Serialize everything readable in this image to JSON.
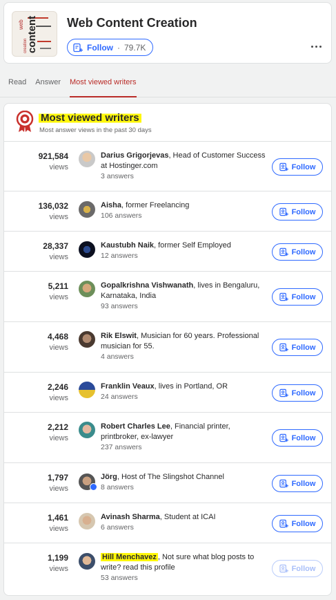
{
  "topic": {
    "title": "Web Content Creation",
    "image_words": [
      "web",
      "content",
      "creation"
    ],
    "follow_label": "Follow",
    "follower_count": "79.7K"
  },
  "tabs": [
    {
      "label": "Read",
      "active": false
    },
    {
      "label": "Answer",
      "active": false
    },
    {
      "label": "Most viewed writers",
      "active": true
    }
  ],
  "writers_section": {
    "title": "Most viewed writers",
    "subtitle": "Most answer views in the past 30 days",
    "views_label": "views",
    "follow_label": "Follow",
    "writers": [
      {
        "views": "921,584",
        "name": "Darius Grigorjevas",
        "cred": ", Head of Customer Success at Hostinger.com",
        "answers": "3 answers"
      },
      {
        "views": "136,032",
        "name": "Aisha",
        "cred": ", former Freelancing",
        "answers": "106 answers"
      },
      {
        "views": "28,337",
        "name": "Kaustubh Naik",
        "cred": ", former Self Employed",
        "answers": "12 answers"
      },
      {
        "views": "5,211",
        "name": "Gopalkrishna Vishwanath",
        "cred": ", lives in Bengaluru, Karnataka, India",
        "answers": "93 answers"
      },
      {
        "views": "4,468",
        "name": "Rik Elswit",
        "cred": ", Musician for 60 years. Professional musician for 55.",
        "answers": "4 answers"
      },
      {
        "views": "2,246",
        "name": "Franklin Veaux",
        "cred": ", lives in Portland, OR",
        "answers": "24 answers"
      },
      {
        "views": "2,212",
        "name": "Robert Charles Lee",
        "cred": ", Financial printer, printbroker, ex-lawyer",
        "answers": "237 answers"
      },
      {
        "views": "1,797",
        "name": "Jörg",
        "cred": ", Host of The Slingshot Channel",
        "answers": "8 answers"
      },
      {
        "views": "1,461",
        "name": "Avinash Sharma",
        "cred": ", Student at ICAI",
        "answers": "6 answers"
      },
      {
        "views": "1,199",
        "name": "Hill Menchavez",
        "cred": ", Not sure what blog posts to write? read this profile",
        "answers": "53 answers"
      }
    ]
  },
  "colors": {
    "accent_blue": "#2e69ff",
    "tab_active_red": "#b92b27",
    "highlight_yellow": "#fff70a"
  }
}
